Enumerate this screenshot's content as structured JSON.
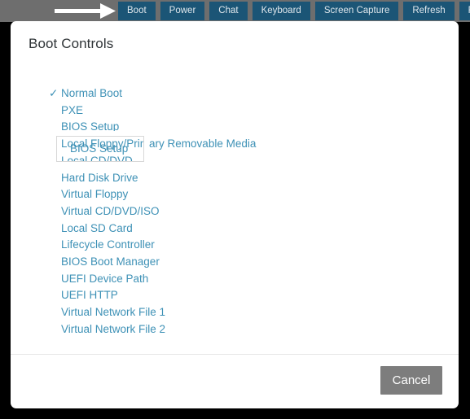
{
  "toolbar": {
    "background_color": "#6e6e6e",
    "button_color": "#1b5576",
    "buttons": [
      {
        "label": "Boot"
      },
      {
        "label": "Power"
      },
      {
        "label": "Chat"
      },
      {
        "label": "Keyboard"
      },
      {
        "label": "Screen Capture"
      },
      {
        "label": "Refresh"
      },
      {
        "label": "Full S"
      }
    ],
    "annotation": {
      "type": "arrow",
      "direction": "right",
      "color": "#ffffff",
      "points_to": "Boot"
    }
  },
  "dialog": {
    "title": "Boot Controls",
    "link_color": "#3e91b6",
    "selected_marker": "✓",
    "boot_options": [
      {
        "label": "Normal Boot",
        "selected": true
      },
      {
        "label": "PXE",
        "selected": false
      },
      {
        "label": "BIOS Setup",
        "selected": false,
        "highlighted": true
      },
      {
        "label": "Local Floppy/Primary Removable Media",
        "selected": false
      },
      {
        "label": "Local CD/DVD",
        "selected": false
      },
      {
        "label": "Hard Disk Drive",
        "selected": false
      },
      {
        "label": "Virtual Floppy",
        "selected": false
      },
      {
        "label": "Virtual CD/DVD/ISO",
        "selected": false
      },
      {
        "label": "Local SD Card",
        "selected": false
      },
      {
        "label": "Lifecycle Controller",
        "selected": false
      },
      {
        "label": "BIOS Boot Manager",
        "selected": false
      },
      {
        "label": "UEFI Device Path",
        "selected": false
      },
      {
        "label": "UEFI HTTP",
        "selected": false
      },
      {
        "label": "Virtual Network File 1",
        "selected": false
      },
      {
        "label": "Virtual Network File 2",
        "selected": false
      }
    ],
    "highlight_label": "BIOS Setup",
    "footer": {
      "cancel_label": "Cancel",
      "cancel_color": "#7d7d7d"
    }
  }
}
